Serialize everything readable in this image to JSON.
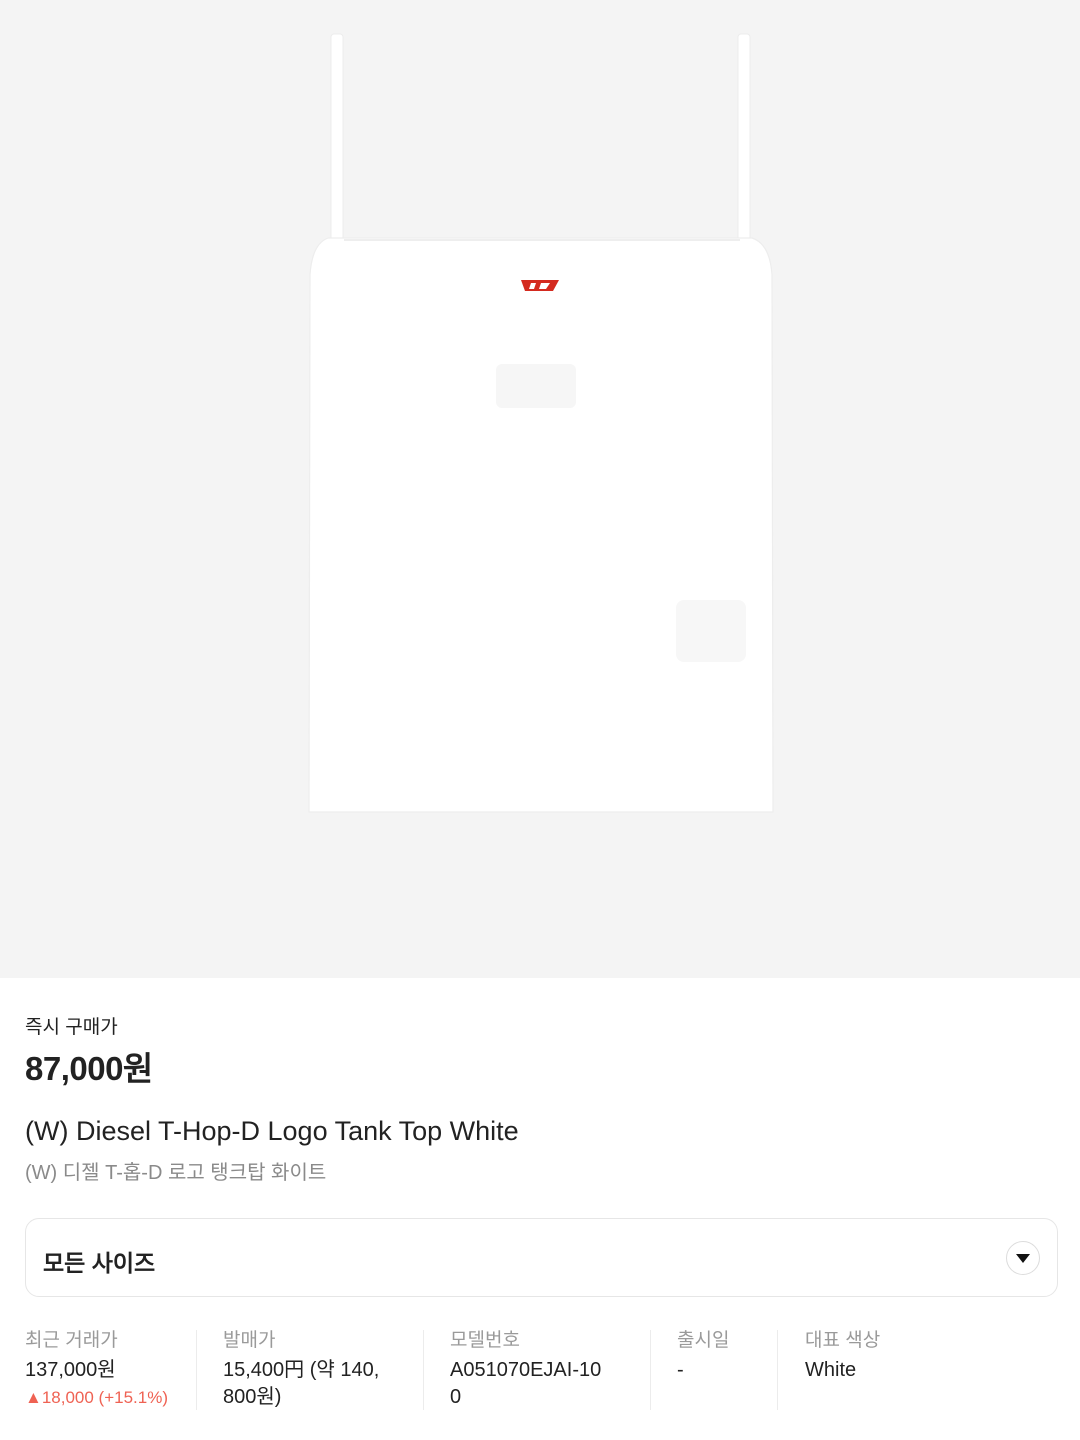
{
  "product": {
    "buy_now_label": "즉시 구매가",
    "buy_now_price": "87,000원",
    "name_en": "(W) Diesel T-Hop-D Logo Tank Top White",
    "name_ko": "(W) 디젤 T-홉-D 로고 탱크탑 화이트",
    "image_icon": "white-tank-top-photo",
    "logo_color": "#d42a1f"
  },
  "size_selector": {
    "label": "모든 사이즈",
    "icon": "chevron-down-icon"
  },
  "info": {
    "recent_trade": {
      "label": "최근 거래가",
      "value": "137,000원",
      "change": "▲18,000 (+15.1%)",
      "change_color": "#ef6253"
    },
    "release_price": {
      "label": "발매가",
      "value_line1": "15,400円 (약 140,",
      "value_line2": "800원)"
    },
    "model_number": {
      "label": "모델번호",
      "value_line1": "A051070EJAI-10",
      "value_line2": "0"
    },
    "release_date": {
      "label": "출시일",
      "value": "-"
    },
    "main_color": {
      "label": "대표 색상",
      "value": "White"
    }
  }
}
